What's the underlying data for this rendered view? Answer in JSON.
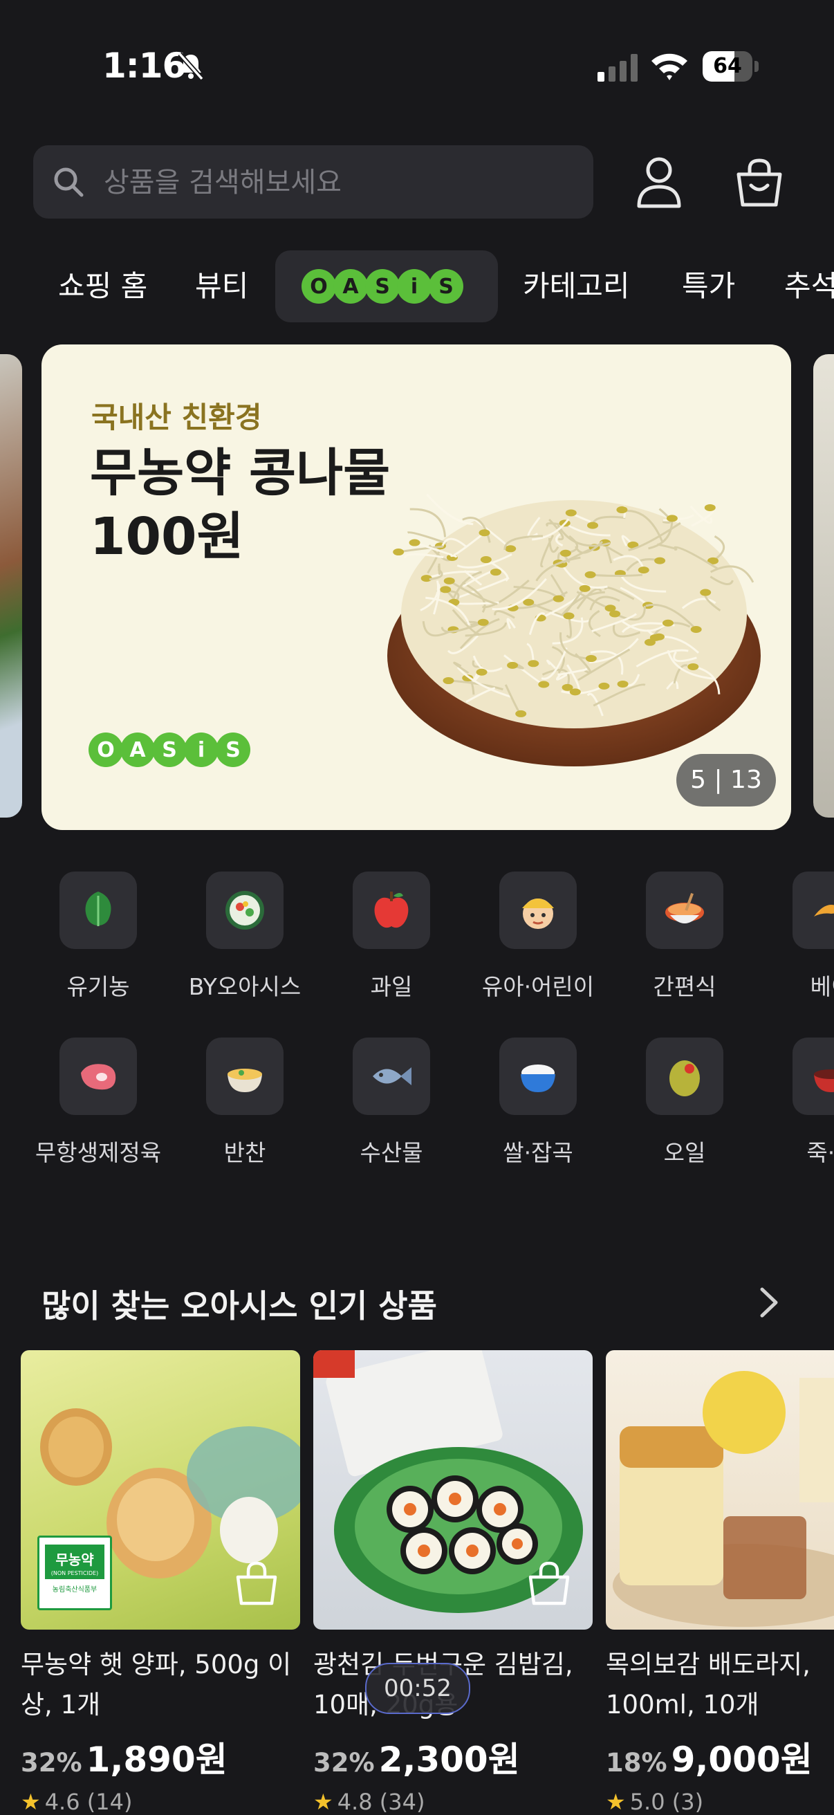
{
  "status_bar": {
    "time": "1:16",
    "battery": "64",
    "battery_level": 0.64
  },
  "search": {
    "placeholder": "상품을 검색해보세요"
  },
  "tabs": [
    {
      "label": "쇼핑 홈"
    },
    {
      "label": "뷰티"
    },
    {
      "label": "OASiS",
      "active": true
    },
    {
      "label": "카테고리"
    },
    {
      "label": "특가"
    },
    {
      "label": "추석"
    }
  ],
  "banner": {
    "subtitle": "국내산 친환경",
    "title": "무농약 콩나물 100원",
    "logo": "OASiS",
    "pager": "5 | 13"
  },
  "categories_row1": [
    {
      "label": "유기농",
      "icon": "leafy-green-icon"
    },
    {
      "label": "BY오아시스",
      "icon": "salad-bowl-icon"
    },
    {
      "label": "과일",
      "icon": "apple-icon"
    },
    {
      "label": "유아·어린이",
      "icon": "child-face-icon"
    },
    {
      "label": "간편식",
      "icon": "noodle-bowl-icon"
    },
    {
      "label": "베이",
      "icon": "croissant-icon"
    }
  ],
  "categories_row2": [
    {
      "label": "무항생제정육",
      "icon": "meat-icon"
    },
    {
      "label": "반찬",
      "icon": "side-dish-icon"
    },
    {
      "label": "수산물",
      "icon": "fish-icon"
    },
    {
      "label": "쌀·잡곡",
      "icon": "rice-bowl-icon"
    },
    {
      "label": "오일",
      "icon": "olive-icon"
    },
    {
      "label": "죽·스",
      "icon": "soup-icon"
    }
  ],
  "section": {
    "title": "많이 찾는 오아시스 인기 상품"
  },
  "products": [
    {
      "name": "무농약 햇 양파, 500g 이상, 1개",
      "discount": "32%",
      "price": "1,890원",
      "rating": "4.6 (14)",
      "badge": "무농약",
      "badge_sub": "(NON PESTICIDE)",
      "badge_org": "농림축산식품부"
    },
    {
      "name": "광천김 두번구운 김밥김, 10매, 20g용",
      "discount": "32%",
      "price": "2,300원",
      "rating": "4.8 (34)"
    },
    {
      "name": "목의보감 배도라지, 100ml, 10개",
      "discount": "18%",
      "price": "9,000원",
      "rating": "5.0 (3)"
    }
  ],
  "overlay": {
    "timer": "00:52"
  }
}
